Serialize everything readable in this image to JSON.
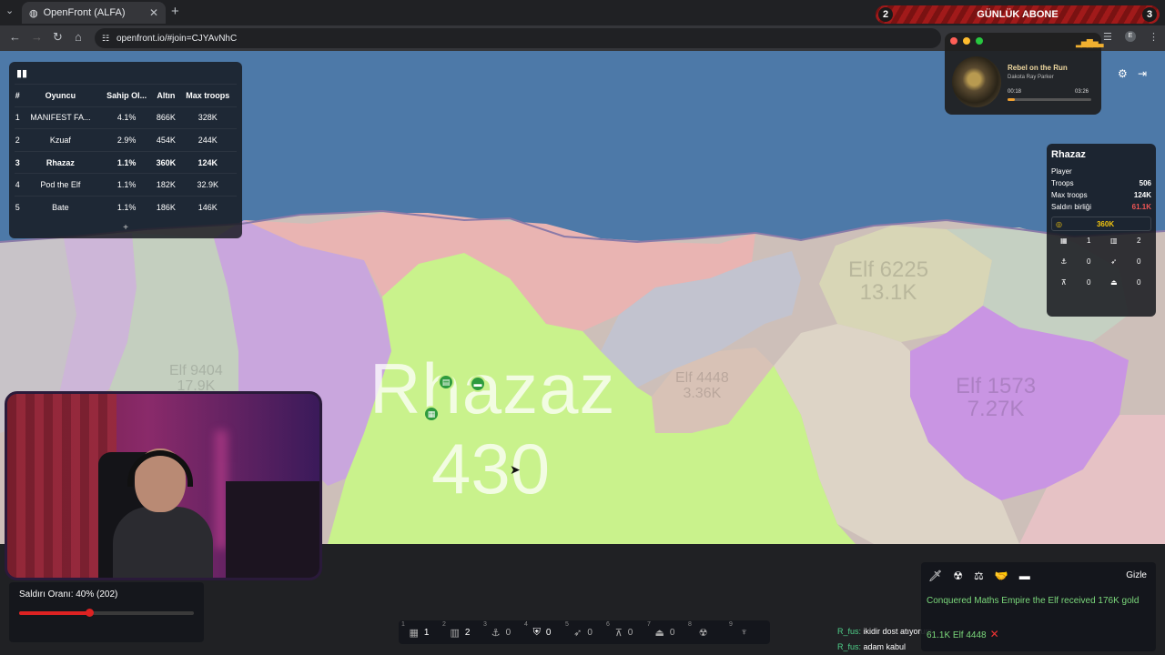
{
  "browser": {
    "tab_title": "OpenFront (ALFA)",
    "url": "openfront.io/#join=CJYAvNhC"
  },
  "subscriber_banner": {
    "left_count": "2",
    "text": "GÜNLÜK ABONE",
    "right_count": "3"
  },
  "music_player": {
    "title": "Rebel on the Run",
    "artist": "Dakota Ray Parker",
    "elapsed": "00:18",
    "duration": "03:26",
    "progress_fraction": 0.09
  },
  "leaderboard": {
    "columns": [
      "#",
      "Oyuncu",
      "Sahip Ol...",
      "Altın",
      "Max troops"
    ],
    "rows": [
      {
        "rank": "1",
        "player": "MANIFEST FA...",
        "owned": "4.1%",
        "gold": "866K",
        "max_troops": "328K"
      },
      {
        "rank": "2",
        "player": "Kzuaf",
        "owned": "2.9%",
        "gold": "454K",
        "max_troops": "244K"
      },
      {
        "rank": "3",
        "player": "Rhazaz",
        "owned": "1.1%",
        "gold": "360K",
        "max_troops": "124K"
      },
      {
        "rank": "4",
        "player": "Pod the Elf",
        "owned": "1.1%",
        "gold": "182K",
        "max_troops": "32.9K"
      },
      {
        "rank": "5",
        "player": "Bate",
        "owned": "1.1%",
        "gold": "186K",
        "max_troops": "146K"
      }
    ],
    "more_label": "+"
  },
  "player_info": {
    "name": "Rhazaz",
    "type": "Player",
    "troops_label": "Troops",
    "troops": "506",
    "max_troops_label": "Max troops",
    "max_troops": "124K",
    "attack_label": "Saldırı birliği",
    "attack": "61.1K",
    "gold": "360K",
    "cities": "1",
    "factories": "2",
    "ports": "0",
    "missiles": "0",
    "sams": "0",
    "warships": "0"
  },
  "map": {
    "player_name": "Rhazaz",
    "player_troops": "430",
    "territory_labels": [
      {
        "name": "Elf 6225",
        "troops": "13.1K"
      },
      {
        "name": "Elf 9404",
        "troops": "17.9K"
      },
      {
        "name": "Elf 4448",
        "troops": "3.36K"
      },
      {
        "name": "Elf 1573",
        "troops": "7.27K"
      }
    ]
  },
  "attack_ratio": {
    "label": "Saldırı Oranı: 40% (202)",
    "percent": 40
  },
  "build_bar": [
    {
      "key": "1",
      "icon": "city-icon",
      "count": "1"
    },
    {
      "key": "2",
      "icon": "factory-icon",
      "count": "2"
    },
    {
      "key": "3",
      "icon": "port-icon",
      "count": "0"
    },
    {
      "key": "4",
      "icon": "defense-icon",
      "count": "0"
    },
    {
      "key": "5",
      "icon": "missile-silo-icon",
      "count": "0"
    },
    {
      "key": "6",
      "icon": "sam-launcher-icon",
      "count": "0"
    },
    {
      "key": "7",
      "icon": "warship-icon",
      "count": "0"
    },
    {
      "key": "8",
      "icon": "nuke-icon",
      "count": ""
    },
    {
      "key": "9",
      "icon": "hydrogen-bomb-icon",
      "count": ""
    }
  ],
  "events": {
    "hide_label": "Gizle",
    "message": "Conquered Maths Empire the Elf received 176K gold",
    "attack_message": "61.1K Elf 4448"
  },
  "chat": [
    {
      "user": "R_fus:",
      "text": "ikidir dost atıyorum"
    },
    {
      "user": "R_fus:",
      "text": "adam kabul"
    }
  ],
  "colors": {
    "ocean": "#4d79a8",
    "player_territory": "#c9f28c",
    "enemy_red": "#e8b6b0",
    "enemy_purple": "#c8a6dc",
    "attack_red": "#dd2222",
    "event_green": "#7bd87b",
    "gold": "#f1c40f"
  }
}
